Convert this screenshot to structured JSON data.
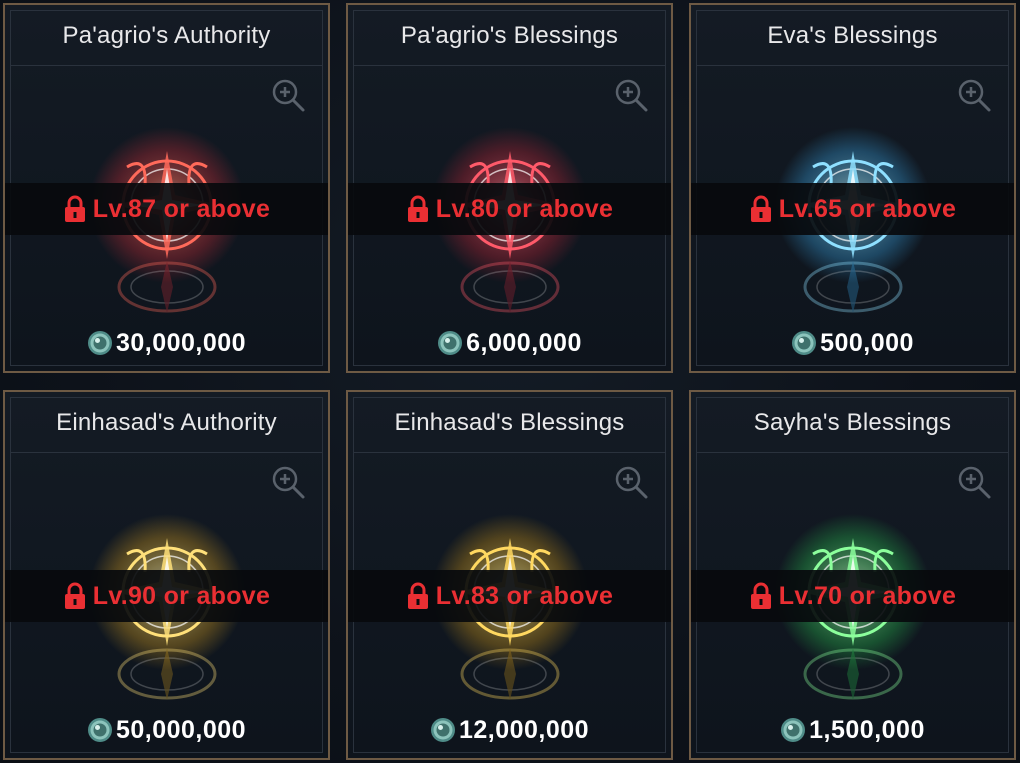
{
  "cards": [
    {
      "title": "Pa'agrio's Authority",
      "lock_label": "Lv.87 or above",
      "price": "30,000,000",
      "accent": "#e0303a",
      "glow": "#ff6a5a"
    },
    {
      "title": "Pa'agrio's Blessings",
      "lock_label": "Lv.80 or above",
      "price": "6,000,000",
      "accent": "#d8283a",
      "glow": "#ff5a6a"
    },
    {
      "title": "Eva's Blessings",
      "lock_label": "Lv.65 or above",
      "price": "500,000",
      "accent": "#3fb8ff",
      "glow": "#8fe0ff"
    },
    {
      "title": "Einhasad's Authority",
      "lock_label": "Lv.90 or above",
      "price": "50,000,000",
      "accent": "#f0b020",
      "glow": "#ffe07a"
    },
    {
      "title": "Einhasad's Blessings",
      "lock_label": "Lv.83 or above",
      "price": "12,000,000",
      "accent": "#e8a818",
      "glow": "#ffd860"
    },
    {
      "title": "Sayha's Blessings",
      "lock_label": "Lv.70 or above",
      "price": "1,500,000",
      "accent": "#2ed858",
      "glow": "#8cff9c"
    }
  ],
  "icons": {
    "zoom": "zoom-in-icon",
    "lock": "lock-icon",
    "currency": "adena-coin-icon"
  },
  "colors": {
    "card_border": "#6e5a44",
    "lock_text": "#ea2f33",
    "title_text": "#e8e8ea"
  }
}
